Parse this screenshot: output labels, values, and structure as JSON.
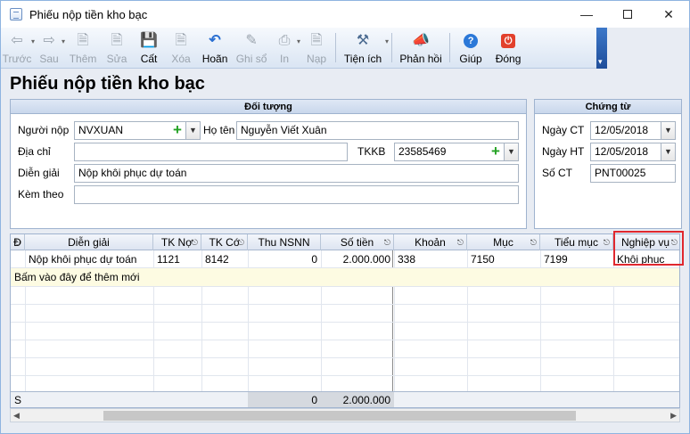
{
  "window": {
    "title": "Phiếu nộp tiền kho bạc"
  },
  "icons": {
    "app": "document-icon",
    "back": "arrow-left-icon",
    "forward": "arrow-right-icon",
    "add": "new-document-icon",
    "edit": "edit-document-icon",
    "save": "floppy-disk-icon",
    "delete": "delete-document-icon",
    "undo": "undo-icon",
    "post": "pencil-icon",
    "print": "printer-icon",
    "unpost": "document-stamp-icon",
    "utilities": "tools-icon",
    "feedback": "megaphone-icon",
    "help": "help-icon",
    "close": "power-icon"
  },
  "toolbar": {
    "back": "Trước",
    "forward": "Sau",
    "add": "Thêm",
    "edit": "Sửa",
    "save": "Cất",
    "delete": "Xóa",
    "undo": "Hoãn",
    "post": "Ghi sổ",
    "print": "In",
    "unpost": "Nạp",
    "utilities": "Tiện ích",
    "feedback": "Phản hồi",
    "help": "Giúp",
    "close": "Đóng"
  },
  "form": {
    "title": "Phiếu nộp tiền kho bạc",
    "object_panel": {
      "header": "Đối tượng",
      "payer_label": "Người nộp",
      "payer_value": "NVXUAN",
      "name_label": "Họ tên",
      "name_value": "Nguyễn Viết Xuân",
      "address_label": "Địa chỉ",
      "address_value": "",
      "tkkb_label": "TKKB",
      "tkkb_value": "23585469",
      "desc_label": "Diễn giải",
      "desc_value": "Nộp khôi phục dự toán",
      "attach_label": "Kèm theo",
      "attach_value": ""
    },
    "voucher_panel": {
      "header": "Chứng từ",
      "date_ct_label": "Ngày CT",
      "date_ct_value": "12/05/2018",
      "date_ht_label": "Ngày HT",
      "date_ht_value": "12/05/2018",
      "number_label": "Số CT",
      "number_value": "PNT00025"
    }
  },
  "grid": {
    "columns": [
      "Đ",
      "Diễn giải",
      "TK Nợ",
      "TK Có",
      "Thu NSNN",
      "Số tiền",
      "Khoản",
      "Mục",
      "Tiểu mục",
      "Nghiệp vụ"
    ],
    "rows": [
      {
        "desc": "Nộp khôi phục dự toán",
        "tk_no": "1121",
        "tk_co": "8142",
        "thu_nsnn": "0",
        "amount": "2.000.000",
        "khoan": "338",
        "muc": "7150",
        "tieu_muc": "7199",
        "nghiep_vu": "Khôi phục"
      }
    ],
    "new_row_hint": "Bấm vào đây để thêm mới",
    "summary": {
      "label": "S",
      "thu_nsnn": "0",
      "amount": "2.000.000"
    }
  },
  "colors": {
    "highlight": "#e0282e",
    "toolbar_accent": "#1f4e9a"
  }
}
